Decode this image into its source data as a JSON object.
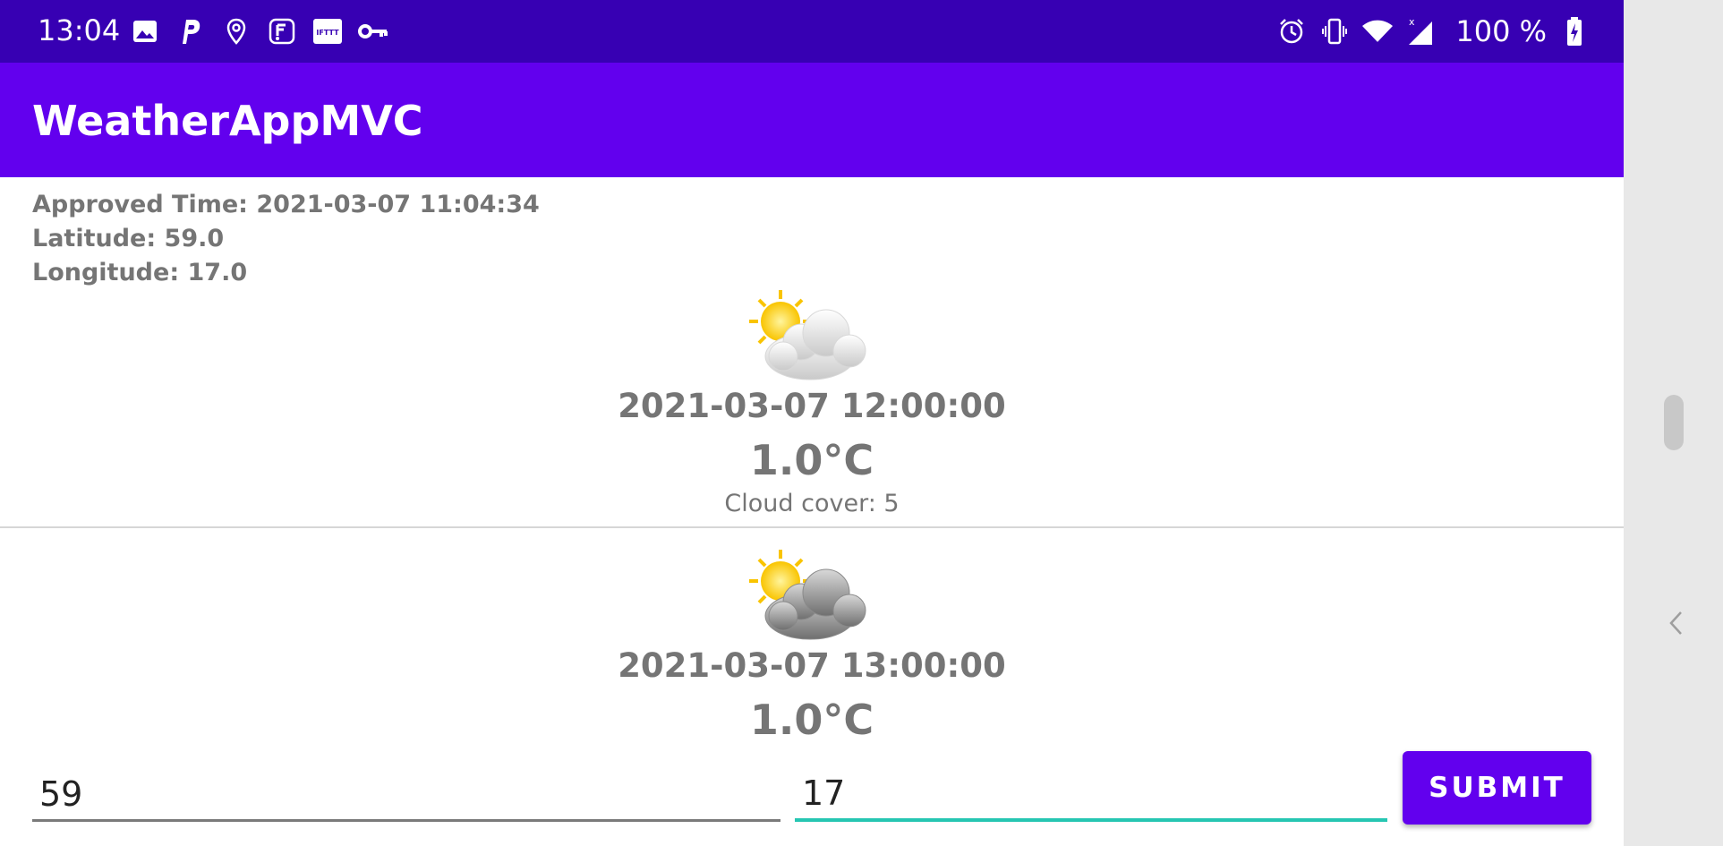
{
  "status_bar": {
    "time": "13:04",
    "battery_text": "100 %",
    "left_icons": [
      "image-icon",
      "p-app-icon",
      "location-pin-icon",
      "foursquare-icon",
      "ifttt-icon",
      "key-icon"
    ],
    "right_icons": [
      "alarm-icon",
      "vibrate-icon",
      "wifi-icon",
      "cell-signal-icon",
      "battery-charging-icon"
    ]
  },
  "app_bar": {
    "title": "WeatherAppMVC"
  },
  "info": {
    "approved_time": "Approved Time: 2021-03-07 11:04:34",
    "latitude": "Latitude: 59.0",
    "longitude": "Longitude: 17.0"
  },
  "forecasts": [
    {
      "icon": "partly-cloudy-sun-icon",
      "time": "2021-03-07 12:00:00",
      "temp": "1.0°C",
      "cloud_cover": "Cloud cover: 5"
    },
    {
      "icon": "sun-dark-cloud-icon",
      "time": "2021-03-07 13:00:00",
      "temp": "1.0°C"
    }
  ],
  "inputs": {
    "latitude_value": "59",
    "longitude_value": "17",
    "submit_label": "SUBMIT"
  },
  "colors": {
    "status_bar": "#3700b3",
    "app_bar": "#6200ee",
    "accent": "#26c6b2",
    "text_secondary": "#757575"
  }
}
